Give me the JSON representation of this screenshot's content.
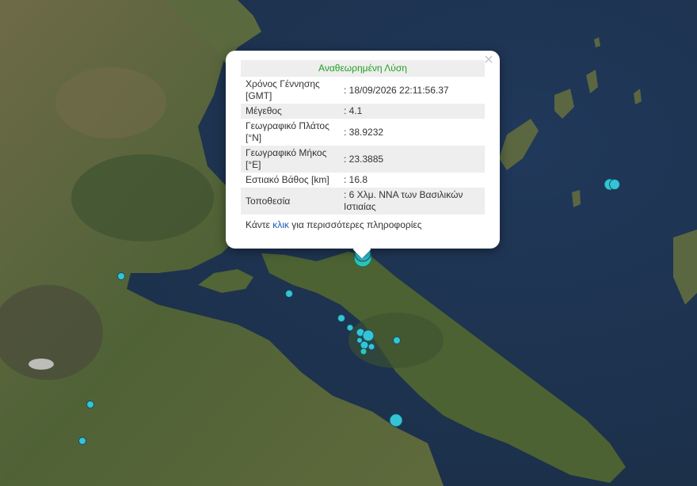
{
  "map": {
    "colors": {
      "sea": "#1f3552",
      "land": "#5c6b3e",
      "land_dark": "#3c5230",
      "marker": "#35c4d6",
      "marker_selected": "#2fc6b3"
    }
  },
  "markers": [
    {
      "id": "m1",
      "selected": true
    },
    {
      "id": "m2"
    },
    {
      "id": "m3"
    },
    {
      "id": "m4"
    },
    {
      "id": "m5"
    },
    {
      "id": "m6"
    },
    {
      "id": "m7"
    },
    {
      "id": "m8"
    },
    {
      "id": "m9"
    },
    {
      "id": "m10"
    },
    {
      "id": "m11"
    },
    {
      "id": "m12"
    },
    {
      "id": "m13"
    },
    {
      "id": "m14"
    },
    {
      "id": "m15"
    },
    {
      "id": "m16"
    },
    {
      "id": "m17"
    },
    {
      "id": "m18"
    }
  ],
  "popup": {
    "title": "Αναθεωρημένη Λύση",
    "rows": [
      {
        "label": "Χρόνος Γέννησης [GMT]",
        "value": ": 18/09/2026 22:11:56.37"
      },
      {
        "label": "Μέγεθος",
        "value": ": 4.1"
      },
      {
        "label": "Γεωγραφικό Πλάτος [°N]",
        "value": ": 38.9232"
      },
      {
        "label": "Γεωγραφικό Μήκος [°E]",
        "value": ": 23.3885"
      },
      {
        "label": "Εστιακό Βάθος [km]",
        "value": ": 16.8"
      },
      {
        "label": "Τοποθεσία",
        "value": ": 6 Χλμ. ΝΝΑ των Βασιλικών Ιστιαίας"
      }
    ],
    "more_prefix": "Κάντε ",
    "more_link": "κλικ",
    "more_suffix": " για περισσότερες πληροφορίες",
    "close_glyph": "×"
  }
}
